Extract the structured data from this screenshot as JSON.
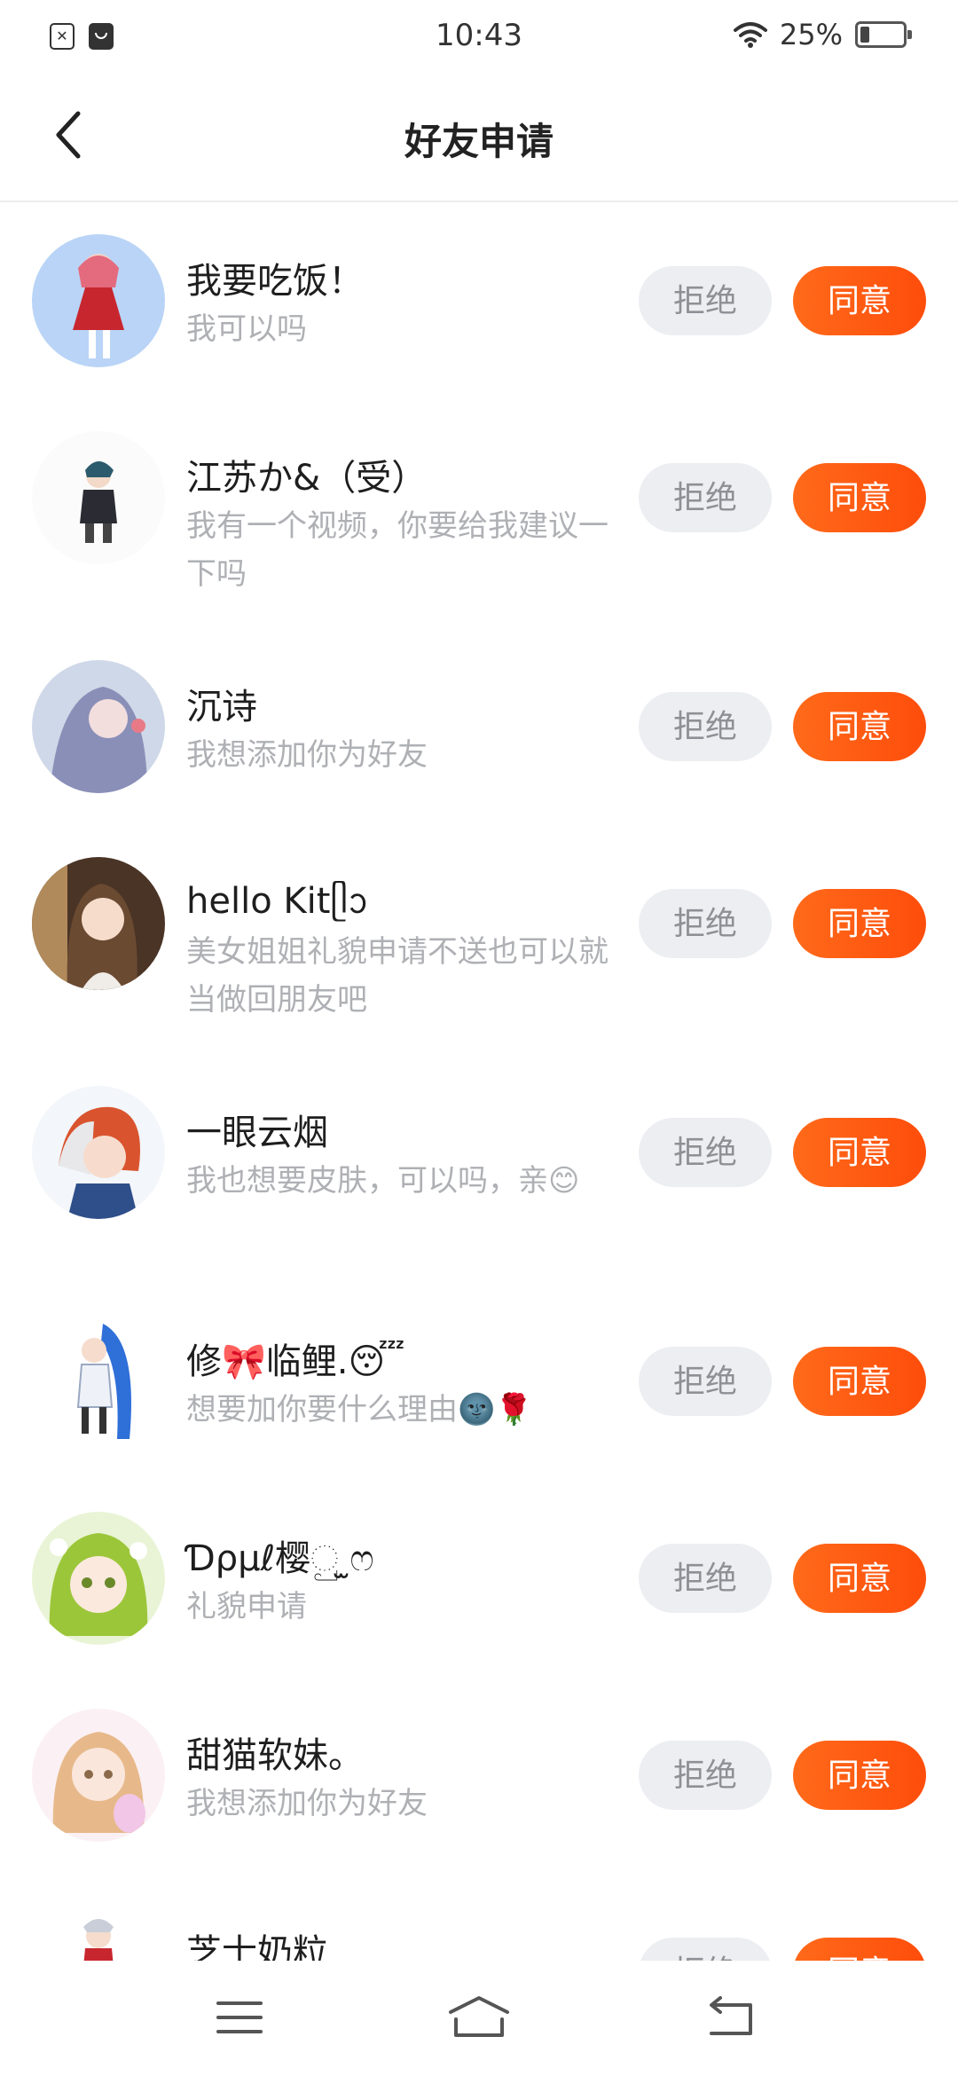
{
  "status_bar": {
    "time": "10:43",
    "battery_text": "25%",
    "battery_level": 0.25,
    "icons": [
      "sim-error-icon",
      "notification-app-icon",
      "wifi-icon",
      "battery-icon"
    ]
  },
  "header": {
    "title": "好友申请",
    "back_icon": "chevron-left-icon"
  },
  "actions": {
    "reject_label": "拒绝",
    "accept_label": "同意"
  },
  "colors": {
    "accent": "#fe5a12",
    "reject_bg": "#eceef2",
    "muted_text": "#aeb0b4"
  },
  "requests": [
    {
      "name": "我要吃饭！",
      "message": "我可以吗"
    },
    {
      "name": "江苏か&（受）",
      "message": "我有一个视频，你要给我建议一下吗"
    },
    {
      "name": "沉诗",
      "message": "我想添加你为好友"
    },
    {
      "name": "hello Kitᥫᩣ",
      "message": "美女姐姐礼貌申请不送也可以就当做回朋友吧"
    },
    {
      "name": "一眼云烟",
      "message": "我也想要皮肤，可以吗，亲😊"
    },
    {
      "name": "修🎀临鲤.😴",
      "message": "想要加你要什么理由🌚🌹"
    },
    {
      "name": "Ɗρµℓ樱ු ̫ෆ",
      "message": "礼貌申请"
    },
    {
      "name": "甜猫软妹。",
      "message": "我想添加你为好友"
    },
    {
      "name": "芝士奶粒",
      "message": ""
    }
  ],
  "nav": {
    "menu_icon": "menu-icon",
    "home_icon": "home-icon",
    "back_icon": "back-arrow-icon"
  }
}
